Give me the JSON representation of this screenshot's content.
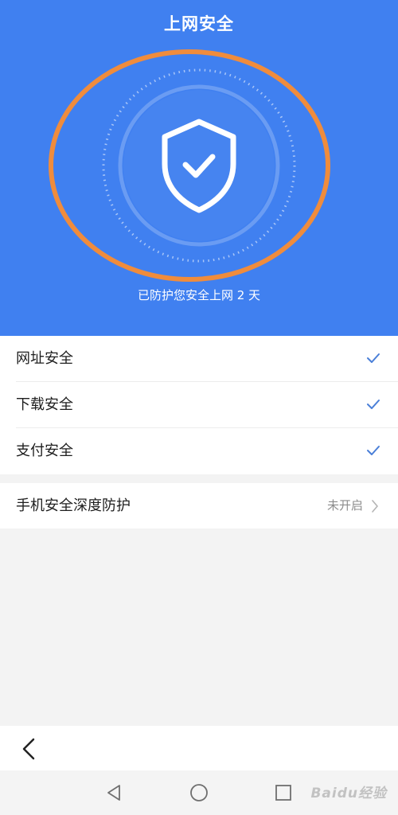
{
  "header": {
    "title": "上网安全"
  },
  "hero": {
    "status_text": "已防护您安全上网 2 天",
    "icon": "shield-check-icon",
    "background_color": "#4080f0",
    "highlight_color": "#f08c3c"
  },
  "protections": [
    {
      "label": "网址安全",
      "checked": true
    },
    {
      "label": "下载安全",
      "checked": true
    },
    {
      "label": "支付安全",
      "checked": true
    }
  ],
  "deep_protection": {
    "label": "手机安全深度防护",
    "status": "未开启"
  },
  "watermark": "Baidu经验",
  "accent_color": "#4a7fd8"
}
